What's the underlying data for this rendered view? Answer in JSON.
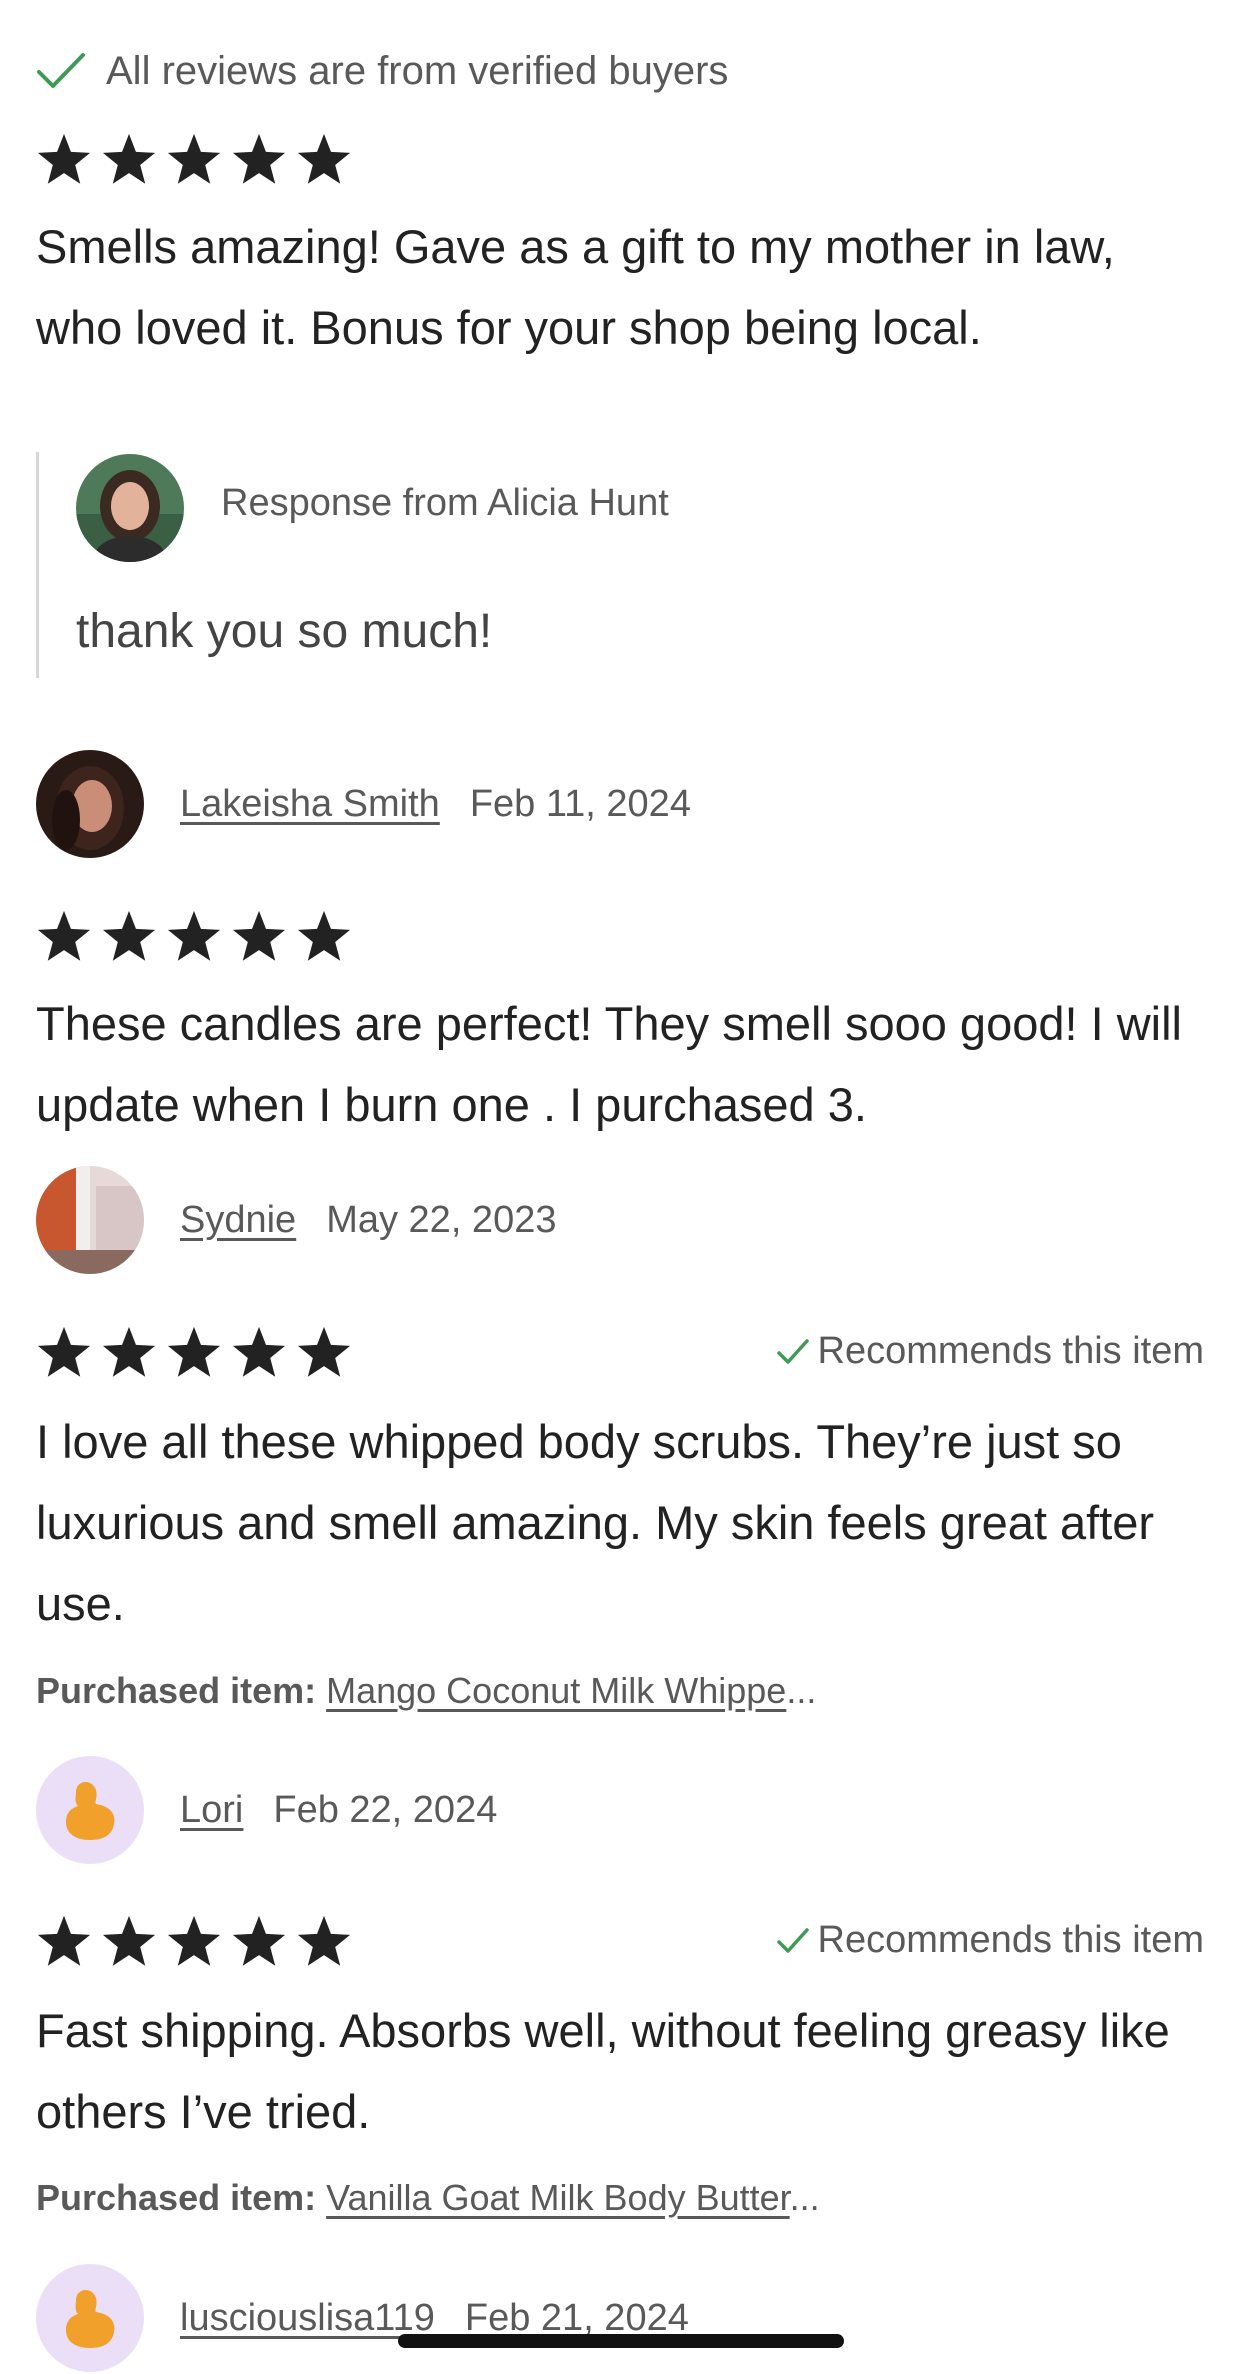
{
  "banner": {
    "text": "All reviews are from verified buyers",
    "icon": "check-icon"
  },
  "reviews": [
    {
      "rating": 5,
      "text": "Smells amazing! Gave as a gift to my mother in law, who loved it. Bonus for your shop being local.",
      "response": {
        "label": "Response from Alicia Hunt",
        "text": "thank you so much!"
      },
      "reviewer": {
        "name": "Lakeisha Smith",
        "date": "Feb 11, 2024"
      }
    },
    {
      "rating": 5,
      "text": "These candles are perfect! They smell sooo good! I will update when I burn one . I purchased 3.",
      "reviewer": {
        "name": "Sydnie",
        "date": "May 22, 2023"
      }
    },
    {
      "rating": 5,
      "recommends": "Recommends this item",
      "text": "I love all these whipped body scrubs. They’re just so luxurious and smell amazing. My skin feels great after use.",
      "purchased": {
        "label": "Purchased item:",
        "item": "Mango Coconut Milk Whippe",
        "ellipsis": "..."
      },
      "reviewer": {
        "name": "Lori",
        "date": "Feb 22, 2024"
      }
    },
    {
      "rating": 5,
      "recommends": "Recommends this item",
      "text": "Fast shipping. Absorbs well, without feeling greasy like others I’ve tried.",
      "purchased": {
        "label": "Purchased item:",
        "item": "Vanilla Goat Milk Body Butter",
        "ellipsis": "..."
      },
      "reviewer": {
        "name": "lusciouslisa119",
        "date": "Feb 21, 2024"
      }
    }
  ],
  "colors": {
    "check_green": "#3f9a55",
    "star": "#222222",
    "muted_text": "#595959",
    "default_avatar_bg": "#eadff7",
    "default_avatar_fg": "#f1a02c"
  }
}
